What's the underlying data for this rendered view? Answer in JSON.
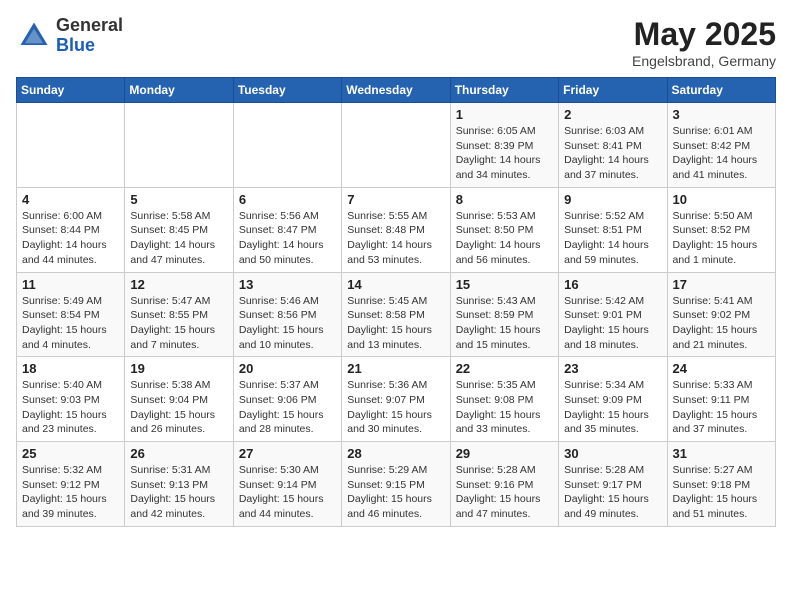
{
  "header": {
    "logo_general": "General",
    "logo_blue": "Blue",
    "month_title": "May 2025",
    "location": "Engelsbrand, Germany"
  },
  "days_of_week": [
    "Sunday",
    "Monday",
    "Tuesday",
    "Wednesday",
    "Thursday",
    "Friday",
    "Saturday"
  ],
  "weeks": [
    [
      {
        "num": "",
        "detail": ""
      },
      {
        "num": "",
        "detail": ""
      },
      {
        "num": "",
        "detail": ""
      },
      {
        "num": "",
        "detail": ""
      },
      {
        "num": "1",
        "detail": "Sunrise: 6:05 AM\nSunset: 8:39 PM\nDaylight: 14 hours\nand 34 minutes."
      },
      {
        "num": "2",
        "detail": "Sunrise: 6:03 AM\nSunset: 8:41 PM\nDaylight: 14 hours\nand 37 minutes."
      },
      {
        "num": "3",
        "detail": "Sunrise: 6:01 AM\nSunset: 8:42 PM\nDaylight: 14 hours\nand 41 minutes."
      }
    ],
    [
      {
        "num": "4",
        "detail": "Sunrise: 6:00 AM\nSunset: 8:44 PM\nDaylight: 14 hours\nand 44 minutes."
      },
      {
        "num": "5",
        "detail": "Sunrise: 5:58 AM\nSunset: 8:45 PM\nDaylight: 14 hours\nand 47 minutes."
      },
      {
        "num": "6",
        "detail": "Sunrise: 5:56 AM\nSunset: 8:47 PM\nDaylight: 14 hours\nand 50 minutes."
      },
      {
        "num": "7",
        "detail": "Sunrise: 5:55 AM\nSunset: 8:48 PM\nDaylight: 14 hours\nand 53 minutes."
      },
      {
        "num": "8",
        "detail": "Sunrise: 5:53 AM\nSunset: 8:50 PM\nDaylight: 14 hours\nand 56 minutes."
      },
      {
        "num": "9",
        "detail": "Sunrise: 5:52 AM\nSunset: 8:51 PM\nDaylight: 14 hours\nand 59 minutes."
      },
      {
        "num": "10",
        "detail": "Sunrise: 5:50 AM\nSunset: 8:52 PM\nDaylight: 15 hours\nand 1 minute."
      }
    ],
    [
      {
        "num": "11",
        "detail": "Sunrise: 5:49 AM\nSunset: 8:54 PM\nDaylight: 15 hours\nand 4 minutes."
      },
      {
        "num": "12",
        "detail": "Sunrise: 5:47 AM\nSunset: 8:55 PM\nDaylight: 15 hours\nand 7 minutes."
      },
      {
        "num": "13",
        "detail": "Sunrise: 5:46 AM\nSunset: 8:56 PM\nDaylight: 15 hours\nand 10 minutes."
      },
      {
        "num": "14",
        "detail": "Sunrise: 5:45 AM\nSunset: 8:58 PM\nDaylight: 15 hours\nand 13 minutes."
      },
      {
        "num": "15",
        "detail": "Sunrise: 5:43 AM\nSunset: 8:59 PM\nDaylight: 15 hours\nand 15 minutes."
      },
      {
        "num": "16",
        "detail": "Sunrise: 5:42 AM\nSunset: 9:01 PM\nDaylight: 15 hours\nand 18 minutes."
      },
      {
        "num": "17",
        "detail": "Sunrise: 5:41 AM\nSunset: 9:02 PM\nDaylight: 15 hours\nand 21 minutes."
      }
    ],
    [
      {
        "num": "18",
        "detail": "Sunrise: 5:40 AM\nSunset: 9:03 PM\nDaylight: 15 hours\nand 23 minutes."
      },
      {
        "num": "19",
        "detail": "Sunrise: 5:38 AM\nSunset: 9:04 PM\nDaylight: 15 hours\nand 26 minutes."
      },
      {
        "num": "20",
        "detail": "Sunrise: 5:37 AM\nSunset: 9:06 PM\nDaylight: 15 hours\nand 28 minutes."
      },
      {
        "num": "21",
        "detail": "Sunrise: 5:36 AM\nSunset: 9:07 PM\nDaylight: 15 hours\nand 30 minutes."
      },
      {
        "num": "22",
        "detail": "Sunrise: 5:35 AM\nSunset: 9:08 PM\nDaylight: 15 hours\nand 33 minutes."
      },
      {
        "num": "23",
        "detail": "Sunrise: 5:34 AM\nSunset: 9:09 PM\nDaylight: 15 hours\nand 35 minutes."
      },
      {
        "num": "24",
        "detail": "Sunrise: 5:33 AM\nSunset: 9:11 PM\nDaylight: 15 hours\nand 37 minutes."
      }
    ],
    [
      {
        "num": "25",
        "detail": "Sunrise: 5:32 AM\nSunset: 9:12 PM\nDaylight: 15 hours\nand 39 minutes."
      },
      {
        "num": "26",
        "detail": "Sunrise: 5:31 AM\nSunset: 9:13 PM\nDaylight: 15 hours\nand 42 minutes."
      },
      {
        "num": "27",
        "detail": "Sunrise: 5:30 AM\nSunset: 9:14 PM\nDaylight: 15 hours\nand 44 minutes."
      },
      {
        "num": "28",
        "detail": "Sunrise: 5:29 AM\nSunset: 9:15 PM\nDaylight: 15 hours\nand 46 minutes."
      },
      {
        "num": "29",
        "detail": "Sunrise: 5:28 AM\nSunset: 9:16 PM\nDaylight: 15 hours\nand 47 minutes."
      },
      {
        "num": "30",
        "detail": "Sunrise: 5:28 AM\nSunset: 9:17 PM\nDaylight: 15 hours\nand 49 minutes."
      },
      {
        "num": "31",
        "detail": "Sunrise: 5:27 AM\nSunset: 9:18 PM\nDaylight: 15 hours\nand 51 minutes."
      }
    ]
  ]
}
